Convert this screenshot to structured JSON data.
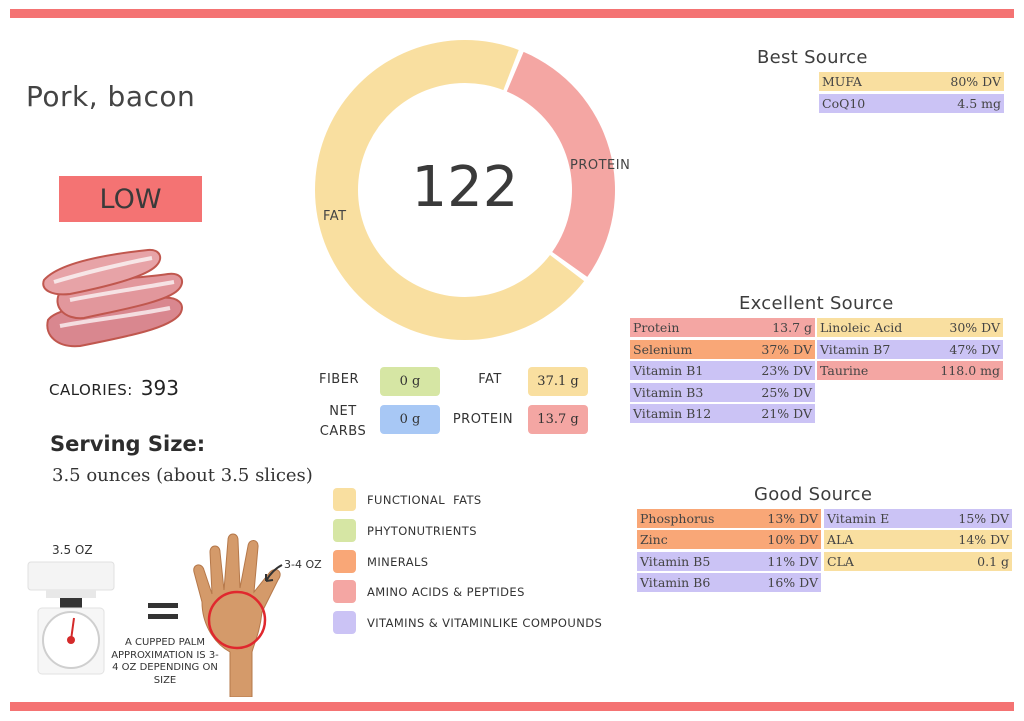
{
  "food": {
    "name": "Pork, bacon",
    "level": "LOW",
    "calories_label": "CALORIES:",
    "calories": "393",
    "serving_heading": "Serving Size:",
    "serving_value": "3.5 ounces (about 3.5 slices)"
  },
  "donut": {
    "center_value": "122",
    "segments": [
      {
        "name": "PROTEIN",
        "percent": 29,
        "color": "#f4a6a3"
      },
      {
        "name": "FAT",
        "percent": 71,
        "color": "#f9dfa0"
      }
    ]
  },
  "macros": {
    "fiber_label": "FIBER",
    "fiber_value": "0 g",
    "net_carbs_label_1": "NET",
    "net_carbs_label_2": "CARBS",
    "net_carbs_value": "0 g",
    "fat_label": "FAT",
    "fat_value": "37.1 g",
    "protein_label": "PROTEIN",
    "protein_value": "13.7 g",
    "colors": {
      "fiber": "#d6e6a4",
      "net_carbs": "#a8c8f5",
      "fat": "#f9dfa0",
      "protein": "#f4a6a3"
    }
  },
  "colors": {
    "accent": "#f47373",
    "functional_fats": "#f9dfa0",
    "phytonutrients": "#d6e6a4",
    "minerals": "#f9a777",
    "amino_acids": "#f4a6a3",
    "vitamins": "#cbc3f5"
  },
  "best_source": {
    "heading": "Best Source",
    "rows": [
      {
        "name": "MUFA",
        "value": "80% DV",
        "category": "functional_fats"
      },
      {
        "name": "CoQ10",
        "value": "4.5 mg",
        "category": "vitamins"
      }
    ]
  },
  "excellent_source": {
    "heading": "Excellent Source",
    "left": [
      {
        "name": "Protein",
        "value": "13.7 g",
        "category": "amino_acids"
      },
      {
        "name": "Selenium",
        "value": "37% DV",
        "category": "minerals"
      },
      {
        "name": "Vitamin B1",
        "value": "23% DV",
        "category": "vitamins"
      },
      {
        "name": "Vitamin B3",
        "value": "25% DV",
        "category": "vitamins"
      },
      {
        "name": "Vitamin B12",
        "value": "21% DV",
        "category": "vitamins"
      }
    ],
    "right": [
      {
        "name": "Linoleic Acid",
        "value": "30% DV",
        "category": "functional_fats"
      },
      {
        "name": "Vitamin B7",
        "value": "47% DV",
        "category": "vitamins"
      },
      {
        "name": "Taurine",
        "value": "118.0 mg",
        "category": "amino_acids"
      }
    ]
  },
  "good_source": {
    "heading": "Good Source",
    "left": [
      {
        "name": "Phosphorus",
        "value": "13% DV",
        "category": "minerals"
      },
      {
        "name": "Zinc",
        "value": "10% DV",
        "category": "minerals"
      },
      {
        "name": "Vitamin B5",
        "value": "11% DV",
        "category": "vitamins"
      },
      {
        "name": "Vitamin B6",
        "value": "16% DV",
        "category": "vitamins"
      }
    ],
    "right": [
      {
        "name": "Vitamin E",
        "value": "15% DV",
        "category": "vitamins"
      },
      {
        "name": "ALA",
        "value": "14% DV",
        "category": "functional_fats"
      },
      {
        "name": "CLA",
        "value": "0.1 g",
        "category": "functional_fats"
      }
    ]
  },
  "legend": [
    {
      "label": "FUNCTIONAL  FATS",
      "category": "functional_fats"
    },
    {
      "label": "PHYTONUTRIENTS",
      "category": "phytonutrients"
    },
    {
      "label": "MINERALS",
      "category": "minerals"
    },
    {
      "label": "AMINO ACIDS & PEPTIDES",
      "category": "amino_acids"
    },
    {
      "label": "VITAMINS & VITAMINLIKE COMPOUNDS",
      "category": "vitamins"
    }
  ],
  "portion": {
    "scale_label": "3.5 OZ",
    "palm_text": "A CUPPED PALM APPROXIMATION IS 3-4 OZ DEPENDING ON SIZE",
    "hand_label": "3-4 OZ"
  }
}
